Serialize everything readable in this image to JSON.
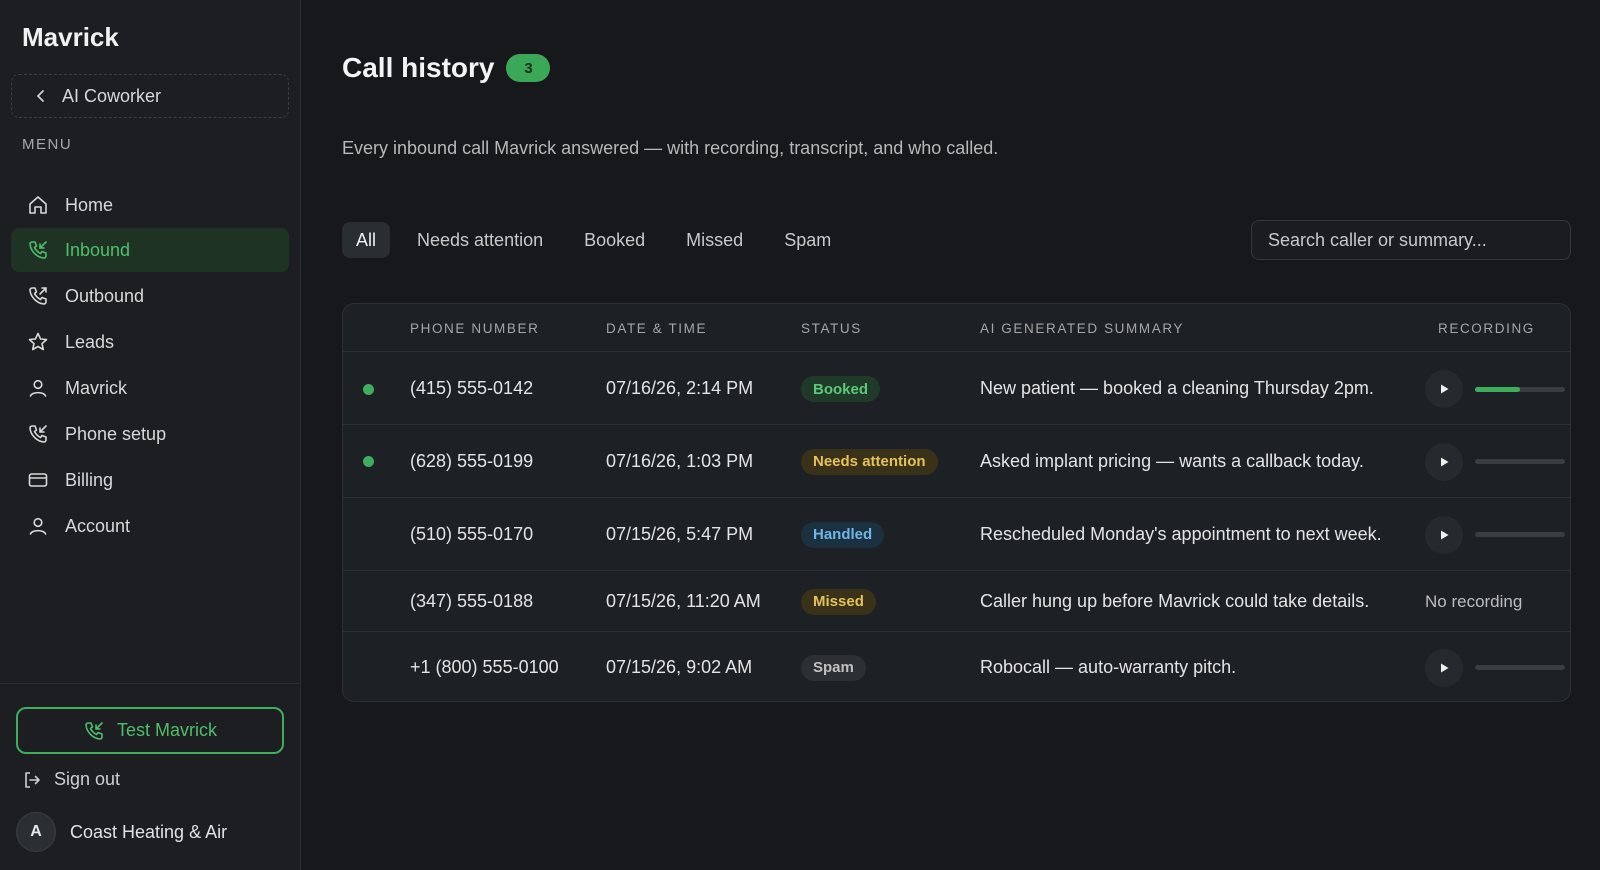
{
  "app": {
    "brand": "Mavrick"
  },
  "sidebar": {
    "back_label": "AI Coworker",
    "menu_label": "MENU",
    "items": [
      {
        "label": "Home",
        "icon": "home-icon",
        "active": false
      },
      {
        "label": "Inbound",
        "icon": "phone-incoming-icon",
        "active": true
      },
      {
        "label": "Outbound",
        "icon": "phone-outgoing-icon",
        "active": false
      },
      {
        "label": "Leads",
        "icon": "star-icon",
        "active": false
      },
      {
        "label": "Mavrick",
        "icon": "user-icon",
        "active": false
      },
      {
        "label": "Phone setup",
        "icon": "phone-setup-icon",
        "active": false
      },
      {
        "label": "Billing",
        "icon": "credit-card-icon",
        "active": false
      },
      {
        "label": "Account",
        "icon": "account-icon",
        "active": false
      }
    ],
    "test_button": "Test Mavrick",
    "sign_out": "Sign out",
    "account": {
      "initial": "A",
      "name": "Coast Heating & Air"
    }
  },
  "main": {
    "title": "Call history",
    "count": "3",
    "subtitle": "Every inbound call Mavrick answered — with recording, transcript, and who called.",
    "tabs": [
      {
        "label": "All",
        "active": true
      },
      {
        "label": "Needs attention",
        "active": false
      },
      {
        "label": "Booked",
        "active": false
      },
      {
        "label": "Missed",
        "active": false
      },
      {
        "label": "Spam",
        "active": false
      }
    ],
    "search_placeholder": "Search caller or summary...",
    "columns": {
      "phone": "PHONE NUMBER",
      "datetime": "DATE & TIME",
      "status": "STATUS",
      "summary": "AI GENERATED SUMMARY",
      "recording": "RECORDING"
    },
    "rows": [
      {
        "phone": "(415) 555-0142",
        "datetime": "07/16/26, 2:14 PM",
        "status": "Booked",
        "status_kind": "booked",
        "summary": "New patient — booked a cleaning Thursday 2pm.",
        "unread": true,
        "has_recording": true,
        "progress": 0.5
      },
      {
        "phone": "(628) 555-0199",
        "datetime": "07/16/26, 1:03 PM",
        "status": "Needs attention",
        "status_kind": "attention",
        "summary": "Asked implant pricing — wants a callback today.",
        "unread": true,
        "has_recording": true,
        "progress": 0
      },
      {
        "phone": "(510) 555-0170",
        "datetime": "07/15/26, 5:47 PM",
        "status": "Handled",
        "status_kind": "handled",
        "summary": "Rescheduled Monday's appointment to next week.",
        "unread": false,
        "has_recording": true,
        "progress": 0
      },
      {
        "phone": "(347) 555-0188",
        "datetime": "07/15/26, 11:20 AM",
        "status": "Missed",
        "status_kind": "missed",
        "summary": "Caller hung up before Mavrick could take details.",
        "unread": false,
        "has_recording": false,
        "no_recording_label": "No recording",
        "progress": 0
      },
      {
        "phone": "+1 (800) 555-0100",
        "datetime": "07/15/26, 9:02 AM",
        "status": "Spam",
        "status_kind": "spam",
        "summary": "Robocall — auto-warranty pitch.",
        "unread": false,
        "has_recording": true,
        "progress": 0
      }
    ],
    "status_colors": {
      "booked": {
        "bg": "#1f3a28",
        "fg": "#5cc97a"
      },
      "attention": {
        "bg": "#3a3218",
        "fg": "#e6c25a"
      },
      "handled": {
        "bg": "#1c3140",
        "fg": "#6fb6e8"
      },
      "missed": {
        "bg": "#3a3218",
        "fg": "#e6c25a"
      },
      "spam": {
        "bg": "#2c2f33",
        "fg": "#c0c0c0"
      }
    }
  }
}
